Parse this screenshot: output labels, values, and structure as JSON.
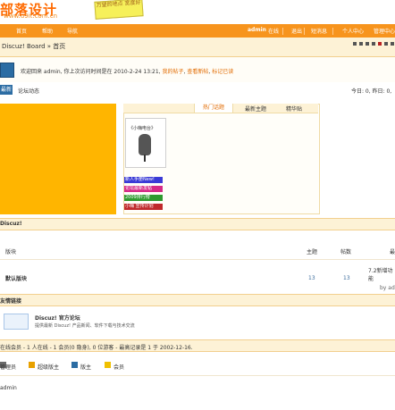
{
  "header": {
    "logo_text": "部落设计",
    "logo_url": "www.u9it.com.cn",
    "badge_text": "万望的地点 宽度好"
  },
  "nav": {
    "items": [
      "首页",
      "帮助",
      "导航"
    ],
    "user": "admin",
    "right_items": [
      "在线",
      "退出",
      "短消息",
      "个人中心",
      "管理中心"
    ]
  },
  "breadcrumb": "Discuz! Board » 首页",
  "welcome": {
    "text": "欢迎回来 admin, 你上次访问时间是在 2010-2-24 13:21,",
    "link1": "我的帖子",
    "link2": "查看新帖",
    "link3": "标记已读"
  },
  "tabs_bar": {
    "new_tab": "最新",
    "forum_activity": "论坛动态",
    "today_stats": "今日: 0, 昨日: 0,"
  },
  "panel_tabs": [
    "热门话题",
    "最新主题",
    "精华贴"
  ],
  "mic_caption": "《小嗨电台》",
  "banners": [
    {
      "text": "新人手册New!",
      "color": "#3a3ad6"
    },
    {
      "text": "论坛最新发帖",
      "color": "#d62a87"
    },
    {
      "text": "2009排行榜",
      "color": "#2f9a2f"
    },
    {
      "text": "小嗨 宣传计划",
      "color": "#c0292b"
    }
  ],
  "forum_section": {
    "title": "Discuz!",
    "col_board": "版块",
    "col_topics": "主题",
    "col_posts": "帖数",
    "col_last": "最",
    "forum_name": "默认版块",
    "topics": "13",
    "posts": "13",
    "last_title": "7.2新增功能",
    "last_by": "by ad"
  },
  "links_section": {
    "title": "友情链接",
    "link_title": "Discuz! 官方论坛",
    "link_desc": "提供最新 Discuz! 产品新闻、软件下载与技术交流"
  },
  "online_section": {
    "text": "在线会员 - 1 人在线 - 1 会员(0 隐身), 0 位游客 - 最高记录是 1 于 2002-12-16.",
    "roles": [
      "管理员",
      "超级版主",
      "版主",
      "会员"
    ],
    "user": "admin"
  },
  "colors": {
    "accent": "#f7941d",
    "yellow_panel": "#ffb500",
    "light_bg": "#fdf2d6",
    "link_orange": "#e26b00",
    "avatar_blue": "#2b6ca3"
  }
}
